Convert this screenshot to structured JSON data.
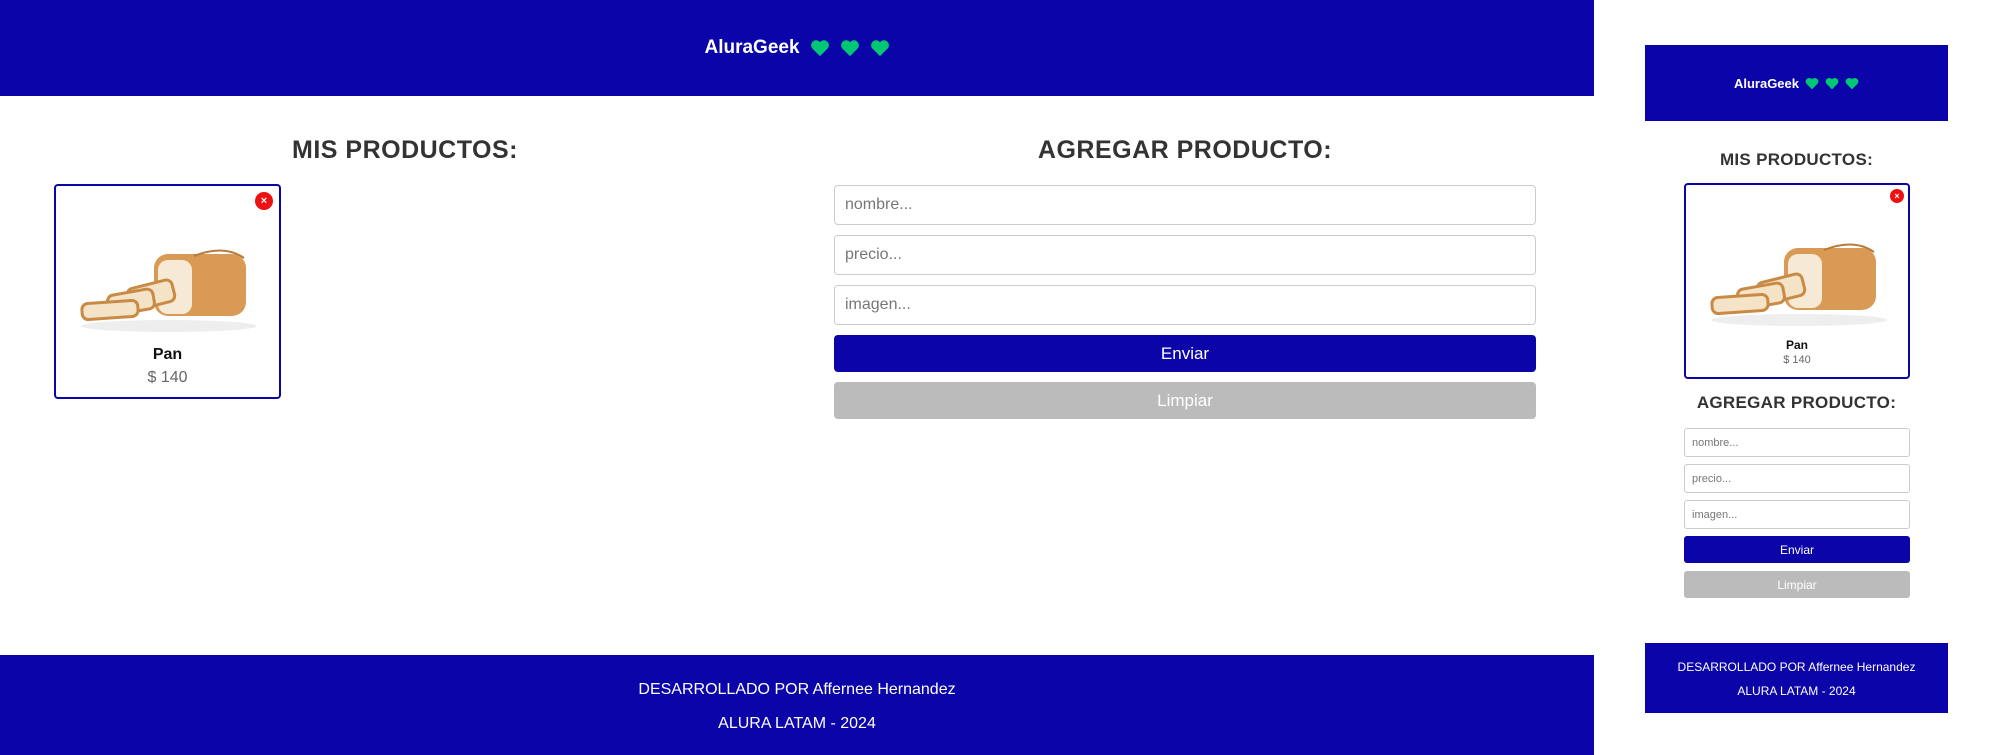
{
  "header": {
    "brand": "AluraGeek",
    "heart_color": "#00c774",
    "heart_count": 3
  },
  "products_section": {
    "title": "MIS PRODUCTOS:",
    "products": [
      {
        "name": "Pan",
        "price": "$ 140",
        "image": "bread-loaf-image",
        "delete_icon": "close-icon"
      }
    ]
  },
  "form": {
    "title": "AGREGAR PRODUCTO:",
    "name_placeholder": "nombre...",
    "price_placeholder": "precio...",
    "image_placeholder": "imagen...",
    "submit_label": "Enviar",
    "clear_label": "Limpiar"
  },
  "footer": {
    "line1": "DESARROLLADO POR Affernee Hernandez",
    "line2": "ALURA LATAM - 2024"
  },
  "colors": {
    "primary": "#0b04a8",
    "clear_button": "#bbbbbb",
    "delete": "#ee1111"
  }
}
